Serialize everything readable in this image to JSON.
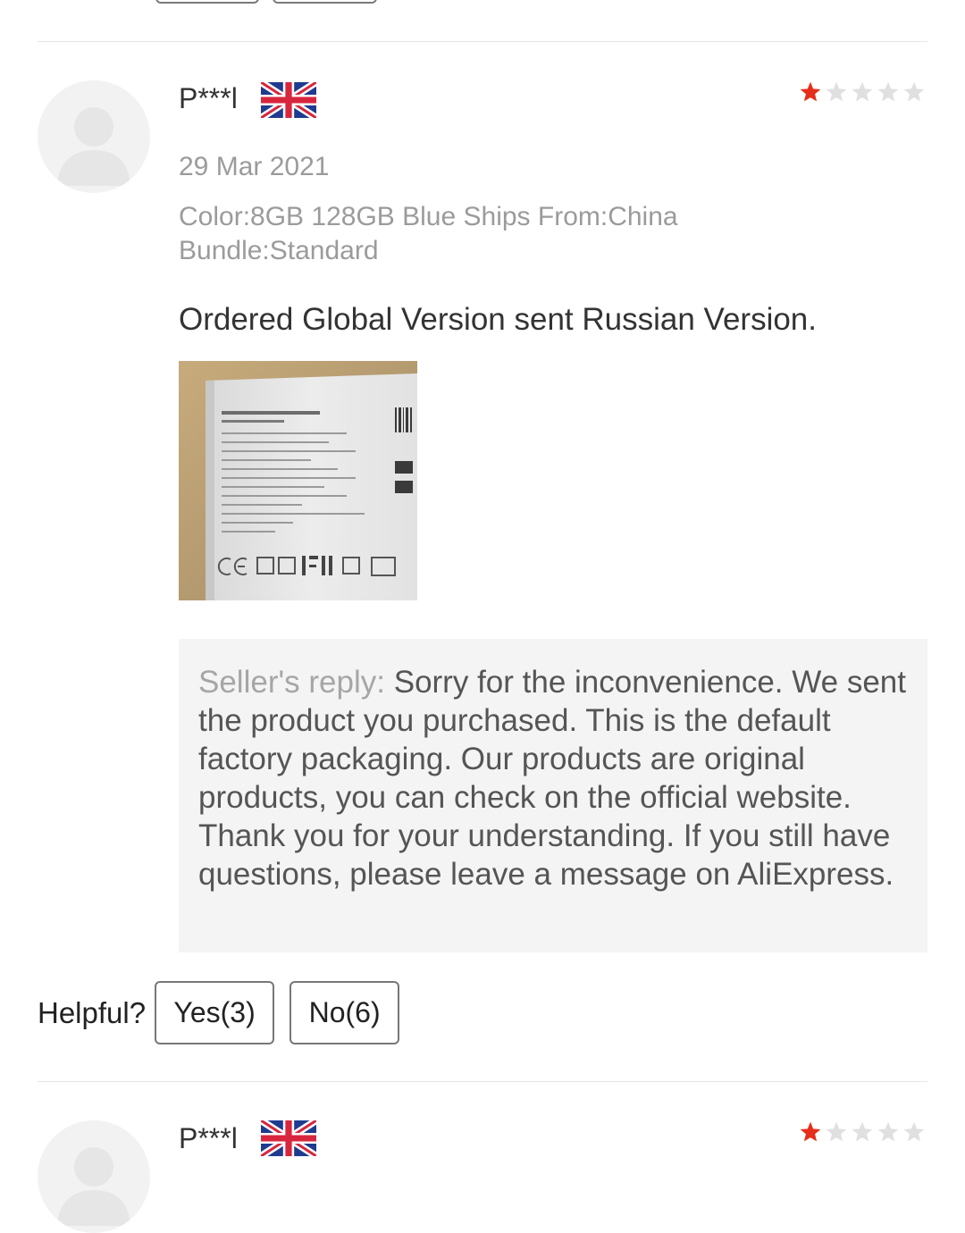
{
  "review": {
    "author": "P***l",
    "country_flag": "uk-flag-icon",
    "rating": 1,
    "rating_max": 5,
    "date": "29 Mar 2021",
    "sku_line1": "Color:8GB 128GB Blue Ships From:China",
    "sku_line2": "Bundle:Standard",
    "text": "Ordered Global Version sent Russian Version.",
    "photo": "box-label-photo",
    "seller_reply_label": "Seller's reply:",
    "seller_reply_text": "Sorry for the inconvenience. We sent the product you purchased. This is the default factory packaging. Our products are original products, you can check on the official website. Thank you for your understanding. If you still have questions, please leave a message on AliExpress.",
    "helpful_label": "Helpful?",
    "yes_label": "Yes(3)",
    "no_label": "No(6)"
  },
  "next_review": {
    "author": "P***l",
    "country_flag": "uk-flag-icon",
    "rating": 1
  },
  "colors": {
    "star_active": "#e62e1b",
    "star_inactive": "#e0e0e0",
    "muted_text": "#9b9b9b",
    "reply_bg": "#f4f4f4"
  }
}
